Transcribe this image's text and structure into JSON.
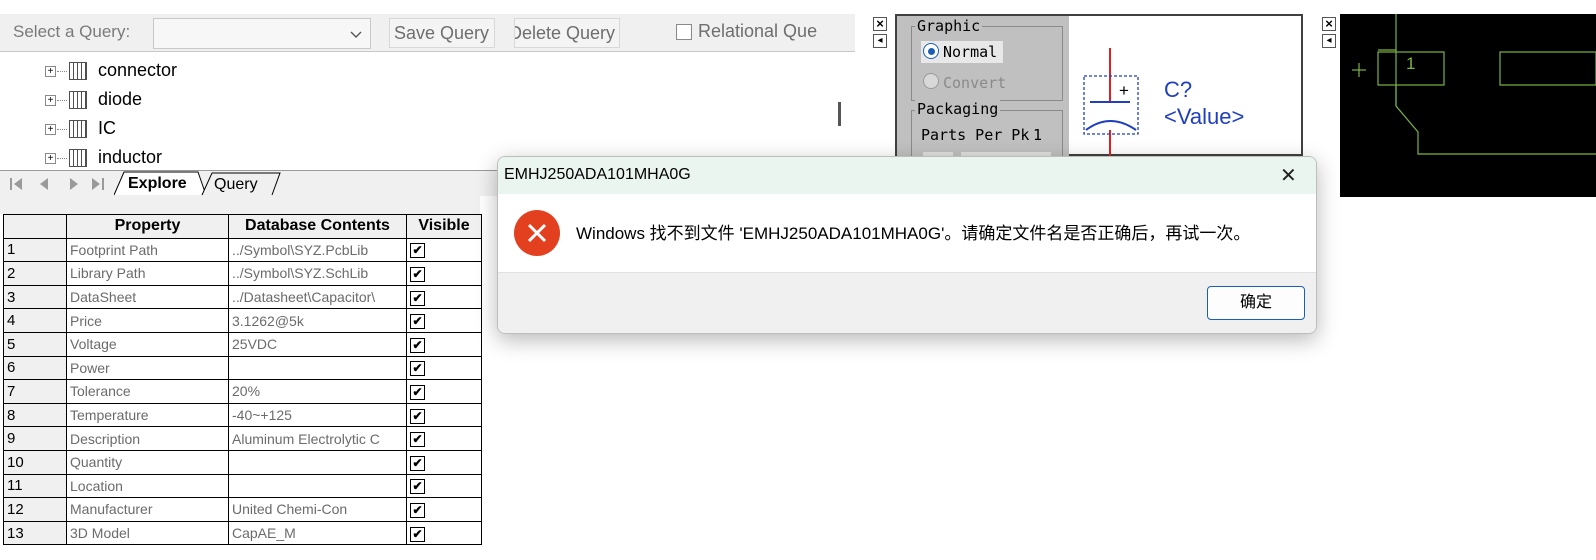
{
  "query_bar": {
    "select_label": "Select a Query:",
    "query_value": "",
    "save_label": "Save Query",
    "delete_label": "Delete Query",
    "relational_label": "Relational Que"
  },
  "tree": {
    "items": [
      {
        "label": "connector"
      },
      {
        "label": "diode"
      },
      {
        "label": "IC"
      },
      {
        "label": "inductor"
      }
    ]
  },
  "tabs": {
    "explore": "Explore",
    "query": "Query"
  },
  "grid": {
    "headers": [
      "Property",
      "Database Contents",
      "Visible"
    ],
    "rows": [
      {
        "num": "1",
        "property": "Footprint Path",
        "value": "../Symbol\\SYZ.PcbLib",
        "visible": true
      },
      {
        "num": "2",
        "property": "Library Path",
        "value": "../Symbol\\SYZ.SchLib",
        "visible": true
      },
      {
        "num": "3",
        "property": "DataSheet",
        "value": "../Datasheet\\Capacitor\\",
        "visible": true
      },
      {
        "num": "4",
        "property": "Price",
        "value": "3.1262@5k",
        "visible": true
      },
      {
        "num": "5",
        "property": "Voltage",
        "value": "25VDC",
        "visible": true
      },
      {
        "num": "6",
        "property": "Power",
        "value": "",
        "visible": true
      },
      {
        "num": "7",
        "property": "Tolerance",
        "value": "20%",
        "visible": true
      },
      {
        "num": "8",
        "property": "Temperature",
        "value": "-40~+125",
        "visible": true
      },
      {
        "num": "9",
        "property": "Description",
        "value": "Aluminum Electrolytic C",
        "visible": true
      },
      {
        "num": "10",
        "property": "Quantity",
        "value": "",
        "visible": true
      },
      {
        "num": "11",
        "property": "Location",
        "value": "",
        "visible": true
      },
      {
        "num": "12",
        "property": "Manufacturer",
        "value": "United Chemi-Con",
        "visible": true
      },
      {
        "num": "13",
        "property": "3D Model",
        "value": "CapAE_M",
        "visible": true
      }
    ]
  },
  "graphic_panel": {
    "graphic_group": "Graphic",
    "normal_label": "Normal",
    "convert_label": "Convert",
    "packaging_group": "Packaging",
    "parts_per_pkg_label": "Parts Per Pk",
    "parts_per_pkg_value": "1",
    "designator": "C?",
    "value_text": "<Value>",
    "plus_sign": "+"
  },
  "pcb_panel": {
    "pad_label": "1",
    "plus_sign": "+"
  },
  "panel_controls": {
    "close_glyph": "×",
    "pin_glyph": "◂"
  },
  "dialog": {
    "title": "EMHJ250ADA101MHA0G",
    "message": "Windows 找不到文件 'EMHJ250ADA101MHA0G'。请确定文件名是否正确后，再试一次。",
    "ok_label": "确定",
    "close_glyph": "✕"
  },
  "colors": {
    "dialog_titlebar": "#eaf5ef",
    "error_icon": "#e3401f",
    "ok_border": "#1a5fb4",
    "schematic_text": "#1f3fbf",
    "pin_red": "#e02020",
    "pcb_green": "#7cb342"
  }
}
